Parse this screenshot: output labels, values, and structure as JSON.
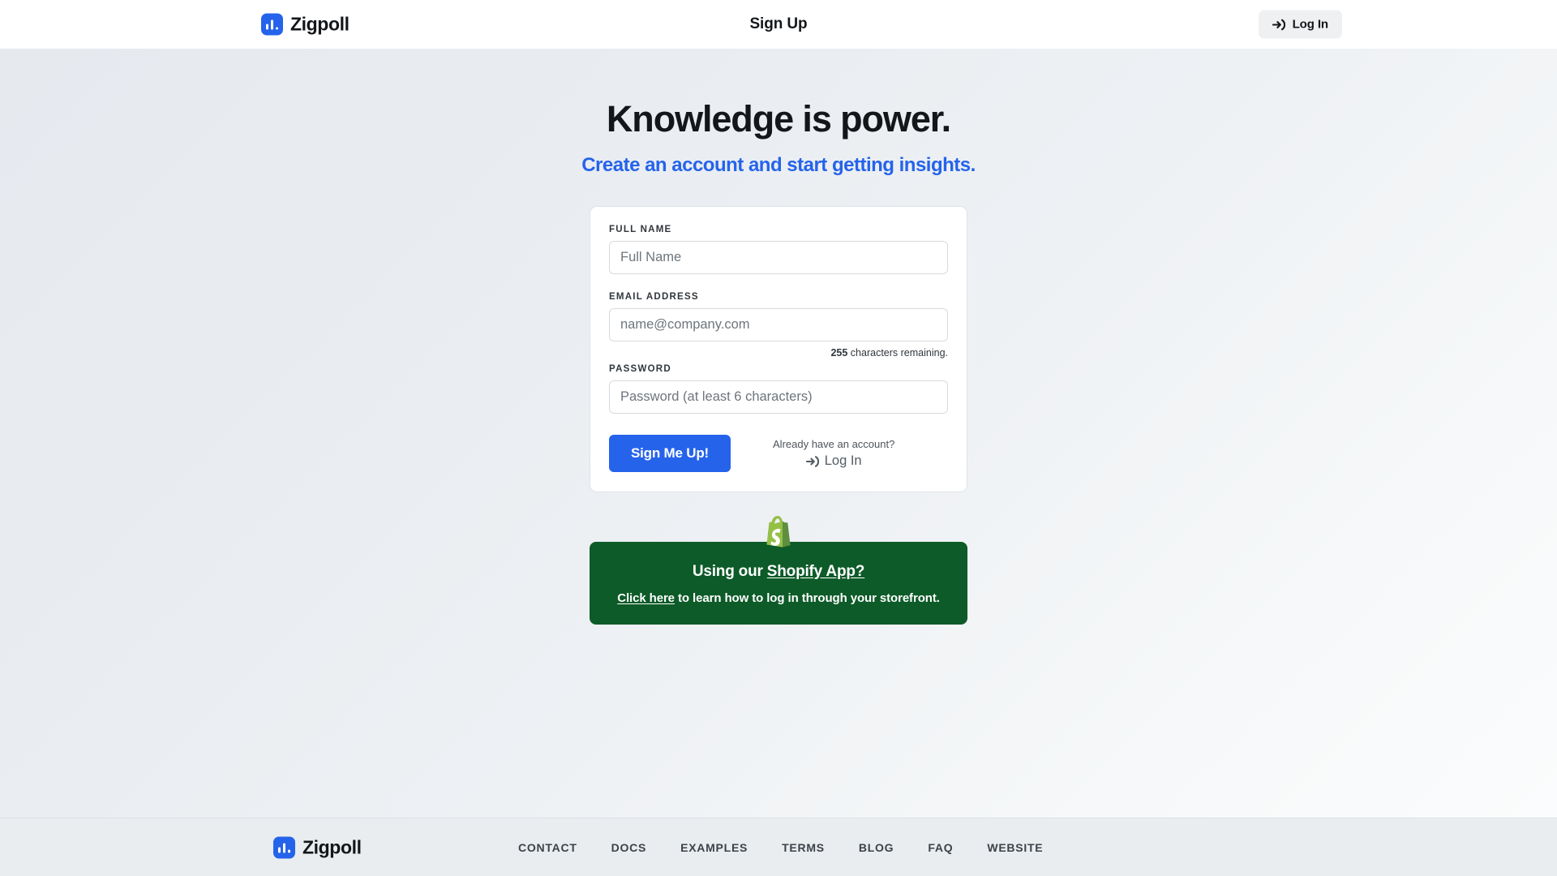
{
  "header": {
    "brand_name": "Zigpoll",
    "brand_icon": "zigpoll-bar-chart-logo",
    "title": "Sign Up",
    "login_button_label": "Log In",
    "login_button_icon": "sign-in-arrow-icon"
  },
  "hero": {
    "title": "Knowledge is power.",
    "subtitle": "Create an account and start getting insights."
  },
  "form": {
    "full_name": {
      "label": "FULL NAME",
      "placeholder": "Full Name",
      "value": ""
    },
    "email": {
      "label": "EMAIL ADDRESS",
      "placeholder": "name@company.com",
      "value": "",
      "counter_number": "255",
      "counter_text": " characters remaining."
    },
    "password": {
      "label": "PASSWORD",
      "placeholder": "Password (at least 6 characters)",
      "value": ""
    },
    "submit_label": "Sign Me Up!",
    "alt_login_prompt": "Already have an account?",
    "alt_login_label": "Log In",
    "alt_login_icon": "sign-in-arrow-icon"
  },
  "shopify_banner": {
    "icon": "shopify-bag-icon",
    "headline_lead": "Using our ",
    "headline_link": "Shopify App?",
    "sub_link": "Click here",
    "sub_rest": " to learn how to log in through your storefront."
  },
  "footer": {
    "brand_name": "Zigpoll",
    "brand_icon": "zigpoll-bar-chart-logo",
    "links": [
      {
        "label": "CONTACT"
      },
      {
        "label": "DOCS"
      },
      {
        "label": "EXAMPLES"
      },
      {
        "label": "TERMS"
      },
      {
        "label": "BLOG"
      },
      {
        "label": "FAQ"
      },
      {
        "label": "WEBSITE"
      }
    ]
  },
  "colors": {
    "accent_blue": "#2563eb",
    "shopify_green": "#0d5b28",
    "shopify_bag_green": "#95bf47",
    "text_dark": "#14171a",
    "page_bg": "#e9edf1"
  }
}
